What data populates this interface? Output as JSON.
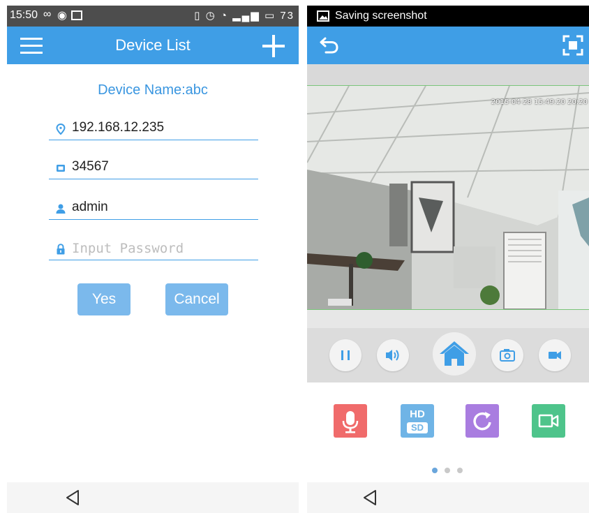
{
  "left_screen": {
    "status_bar": {
      "time": "15:50",
      "battery": "73"
    },
    "app_bar": {
      "title": "Device List"
    },
    "device_name": "Device Name:abc",
    "fields": {
      "ip": {
        "value": "192.168.12.235",
        "icon": "location-pin-icon"
      },
      "port": {
        "value": "34567",
        "icon": "port-icon"
      },
      "username": {
        "value": "admin",
        "icon": "user-icon"
      },
      "password": {
        "placeholder": "Input Password",
        "icon": "lock-icon"
      }
    },
    "buttons": {
      "yes": "Yes",
      "cancel": "Cancel"
    }
  },
  "right_screen": {
    "status_bar": {
      "notification": "Saving screenshot"
    },
    "video": {
      "timestamp": "2015-04-28 15:49:20 20:20"
    },
    "controls": [
      "pause-icon",
      "volume-icon",
      "home-icon",
      "camera-icon",
      "video-record-icon"
    ],
    "features": {
      "microphone": {
        "color": "#f06b6b"
      },
      "quality": {
        "color": "#6fb4e6",
        "top_label": "HD",
        "bottom_label": "SD"
      },
      "rotate": {
        "color": "#a97de0"
      },
      "video_call": {
        "color": "#4ec48b"
      }
    },
    "pager": {
      "active_index": 0,
      "count": 3
    }
  },
  "colors": {
    "accent": "#3f9ee6",
    "button": "#7bb9ec"
  }
}
